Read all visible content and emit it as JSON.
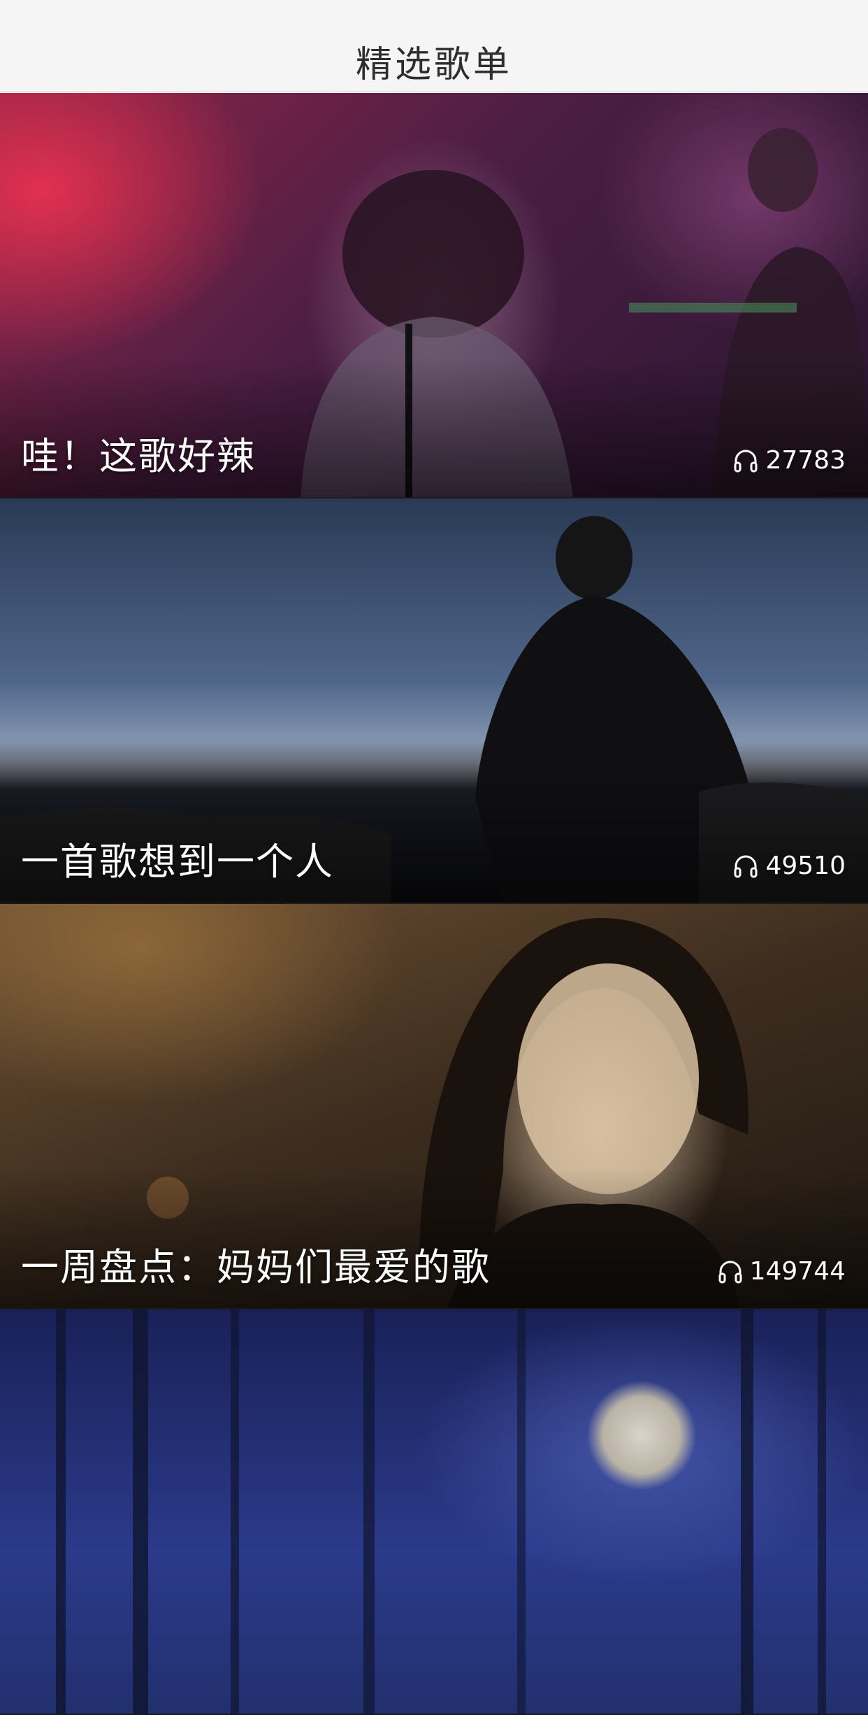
{
  "navbar": {
    "title": "精选歌单"
  },
  "playlists": [
    {
      "name": "哇！这歌好辣",
      "plays": "27783"
    },
    {
      "name": "一首歌想到一个人",
      "plays": "49510"
    },
    {
      "name": "一周盘点：妈妈们最爱的歌",
      "plays": "149744"
    },
    {
      "name": "",
      "plays": ""
    }
  ]
}
